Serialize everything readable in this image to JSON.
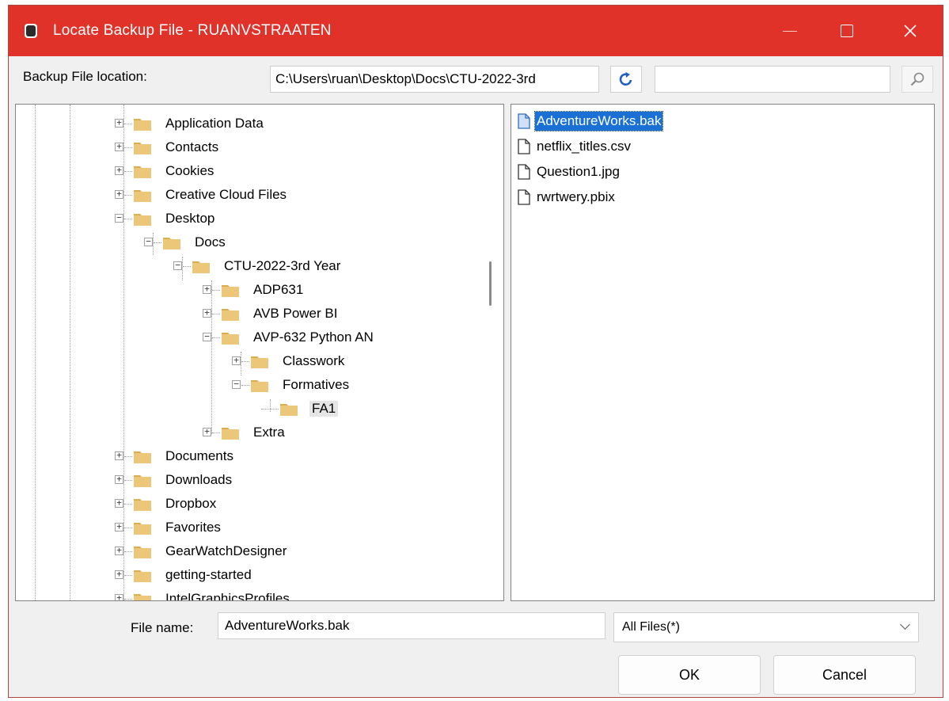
{
  "window": {
    "title": "Locate Backup File - RUANVSTRAATEN",
    "controls": [
      "minimize",
      "maximize",
      "close"
    ]
  },
  "location": {
    "label": "Backup File location:",
    "path": "C:\\Users\\ruan\\Desktop\\Docs\\CTU-2022-3rd",
    "search_value": ""
  },
  "tree": {
    "items": [
      {
        "label": "Application Data",
        "expander": "+"
      },
      {
        "label": "Contacts",
        "expander": "+"
      },
      {
        "label": "Cookies",
        "expander": "+"
      },
      {
        "label": "Creative Cloud Files",
        "expander": "+"
      },
      {
        "label": "Desktop",
        "expander": "-"
      },
      {
        "label": "Docs",
        "expander": "-"
      },
      {
        "label": "CTU-2022-3rd Year",
        "expander": "-"
      },
      {
        "label": "ADP631",
        "expander": "+"
      },
      {
        "label": "AVB Power BI",
        "expander": "+"
      },
      {
        "label": "AVP-632 Python AN",
        "expander": "-"
      },
      {
        "label": "Classwork",
        "expander": "+"
      },
      {
        "label": "Formatives",
        "expander": "-"
      },
      {
        "label": "FA1",
        "expander": "",
        "selected": true
      },
      {
        "label": "Extra",
        "expander": "+"
      },
      {
        "label": "Documents",
        "expander": "+"
      },
      {
        "label": "Downloads",
        "expander": "+"
      },
      {
        "label": "Dropbox",
        "expander": "+"
      },
      {
        "label": "Favorites",
        "expander": "+"
      },
      {
        "label": "GearWatchDesigner",
        "expander": "+"
      },
      {
        "label": "getting-started",
        "expander": "+"
      },
      {
        "label": "IntelGraphicsProfiles",
        "expander": "+"
      }
    ]
  },
  "files": {
    "items": [
      {
        "name": "AdventureWorks.bak",
        "selected": true
      },
      {
        "name": "netflix_titles.csv",
        "selected": false
      },
      {
        "name": "Question1.jpg",
        "selected": false
      },
      {
        "name": "rwrtwery.pbix",
        "selected": false
      }
    ]
  },
  "footer": {
    "file_name_label": "File name:",
    "file_name_value": "AdventureWorks.bak",
    "filter_value": "All Files(*)",
    "ok_label": "OK",
    "cancel_label": "Cancel"
  },
  "colors": {
    "titlebar": "#e1322a",
    "selection": "#1b70d6",
    "folder": "#e8c46f"
  },
  "icons": {
    "title": "database-icon",
    "refresh": "refresh-icon",
    "search": "search-icon",
    "folder": "folder-icon",
    "file": "file-icon"
  }
}
